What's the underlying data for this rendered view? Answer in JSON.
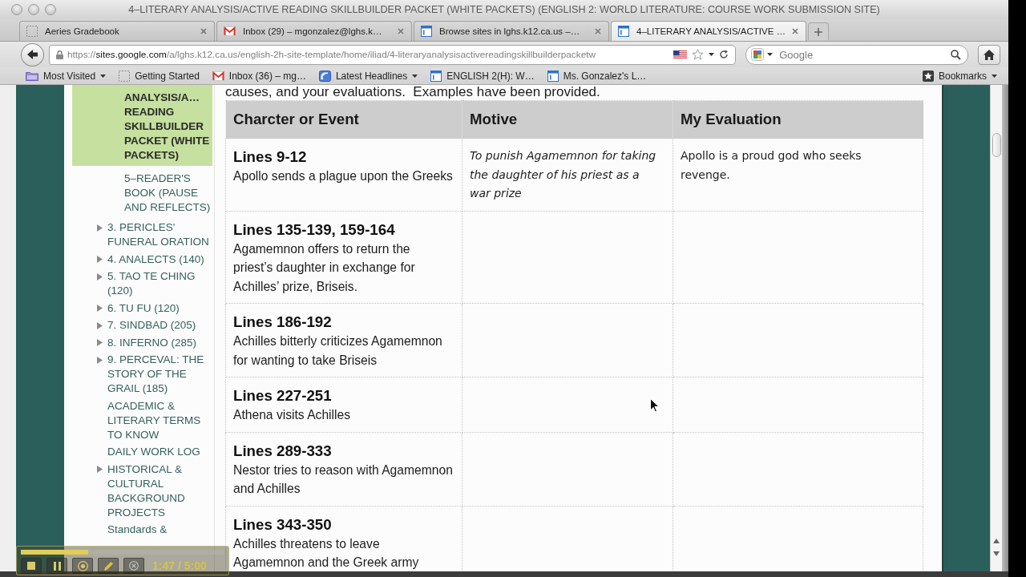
{
  "window": {
    "title": "4–LITERARY ANALYSIS/ACTIVE READING SKILLBUILDER PACKET (WHITE PACKETS) (ENGLISH 2: WORLD LITERATURE: COURSE WORK SUBMISSION SITE)"
  },
  "tabs": [
    {
      "kind": "blank",
      "label": "Aeries Gradebook",
      "selected": false
    },
    {
      "kind": "mail",
      "label": "Inbox (29) – mgonzalez@lghs.k…",
      "selected": false
    },
    {
      "kind": "page",
      "label": "Browse sites in lghs.k12.ca.us –…",
      "selected": false
    },
    {
      "kind": "page",
      "label": "4–LITERARY ANALYSIS/ACTIVE …",
      "selected": true
    }
  ],
  "address_bar": {
    "scheme": "https://",
    "host": "sites.google.com",
    "path": "/a/lghs.k12.ca.us/english-2h-site-template/home/iliad/4-literaryanalysisactivereadingskillbuilderpacketw"
  },
  "search": {
    "placeholder": "Google"
  },
  "bookmarks": [
    {
      "kind": "folder",
      "label": "Most Visited",
      "menu": true
    },
    {
      "kind": "blank",
      "label": "Getting Started",
      "menu": false
    },
    {
      "kind": "mail",
      "label": "Inbox (36) – mg…",
      "menu": false
    },
    {
      "kind": "feed",
      "label": "Latest Headlines",
      "menu": true
    },
    {
      "kind": "page",
      "label": "ENGLISH 2(H): W…",
      "menu": false
    },
    {
      "kind": "page",
      "label": "Ms. Gonzalez's L…",
      "menu": false
    }
  ],
  "bookmarks_menu": {
    "label": "Bookmarks"
  },
  "sidebar": {
    "items": [
      {
        "children": [
          {
            "label": "ANALYSIS/A… READING SKILLBUILDER PACKET (WHITE PACKETS)",
            "selected": true
          },
          {
            "label": "5–READER'S BOOK (PAUSE AND REFLECTS)",
            "selected": false
          }
        ]
      },
      {
        "label": "3. PERICLES' FUNERAL ORATION",
        "expandable": true,
        "selected": false
      },
      {
        "label": "4. ANALECTS (140)",
        "expandable": true,
        "selected": false
      },
      {
        "label": "5. TAO TE CHING (120)",
        "expandable": true,
        "selected": false
      },
      {
        "label": "6. TU FU (120)",
        "expandable": true,
        "selected": false
      },
      {
        "label": "7. SINDBAD (205)",
        "expandable": true,
        "selected": false
      },
      {
        "label": "8. INFERNO (285)",
        "expandable": true,
        "selected": false
      },
      {
        "label": "9. PERCEVAL: THE STORY OF THE GRAIL (185)",
        "expandable": true,
        "selected": false
      },
      {
        "label": "ACADEMIC & LITERARY TERMS TO KNOW",
        "expandable": false,
        "selected": false
      },
      {
        "label": "DAILY WORK LOG",
        "expandable": false,
        "selected": false
      },
      {
        "label": "HISTORICAL & CULTURAL BACKGROUND PROJECTS",
        "expandable": true,
        "selected": false
      },
      {
        "label": "Standards &",
        "expandable": false,
        "selected": false
      }
    ]
  },
  "page": {
    "intro": "causes, and your evaluations.  Examples have been provided.",
    "table": {
      "columns": [
        "Charcter or Event",
        "Motive",
        "My Evaluation"
      ],
      "rows": [
        {
          "lines": "Lines 9-12",
          "event": "Apollo sends a plague upon the Greeks",
          "motive": "To punish Agamemnon for taking the daughter of his priest as a war prize",
          "evaluation": "Apollo is a proud god who seeks revenge."
        },
        {
          "lines": "Lines 135-139, 159-164",
          "event": "Agamemnon offers to return the priest’s daughter in exchange for Achilles’ prize, Briseis."
        },
        {
          "lines": "Lines 186-192",
          "event": "Achilles bitterly criticizes Agamemnon for wanting to take Briseis"
        },
        {
          "lines": "Lines 227-251",
          "event": "Athena visits Achilles"
        },
        {
          "lines": "Lines 289-333",
          "event": "Nestor tries to reason with Agamemnon and Achilles"
        },
        {
          "lines": "Lines 343-350",
          "event": "Achilles threatens to leave Agamemnon and the Greek army"
        }
      ]
    }
  },
  "recorder": {
    "level": 0.33,
    "time": "1:47 / 5:00"
  }
}
